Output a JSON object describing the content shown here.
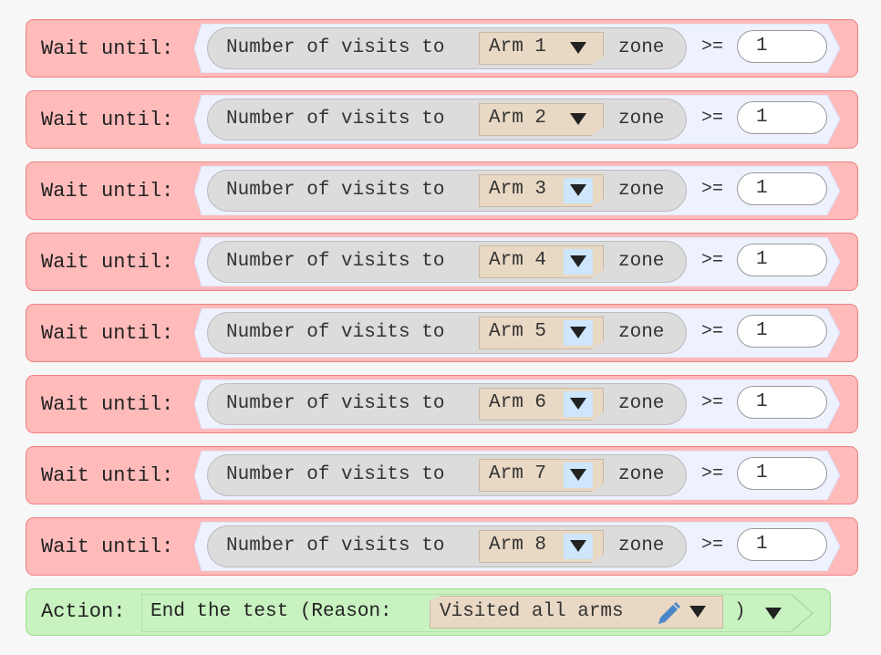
{
  "conditions": [
    {
      "label": "Wait until:",
      "prefix": "Number of visits to",
      "zone": "Arm 1",
      "suffix": "zone",
      "operator": ">=",
      "value": "1",
      "arrow_highlighted": false
    },
    {
      "label": "Wait until:",
      "prefix": "Number of visits to",
      "zone": "Arm 2",
      "suffix": "zone",
      "operator": ">=",
      "value": "1",
      "arrow_highlighted": false
    },
    {
      "label": "Wait until:",
      "prefix": "Number of visits to",
      "zone": "Arm 3",
      "suffix": "zone",
      "operator": ">=",
      "value": "1",
      "arrow_highlighted": true
    },
    {
      "label": "Wait until:",
      "prefix": "Number of visits to",
      "zone": "Arm 4",
      "suffix": "zone",
      "operator": ">=",
      "value": "1",
      "arrow_highlighted": true
    },
    {
      "label": "Wait until:",
      "prefix": "Number of visits to",
      "zone": "Arm 5",
      "suffix": "zone",
      "operator": ">=",
      "value": "1",
      "arrow_highlighted": true
    },
    {
      "label": "Wait until:",
      "prefix": "Number of visits to",
      "zone": "Arm 6",
      "suffix": "zone",
      "operator": ">=",
      "value": "1",
      "arrow_highlighted": true
    },
    {
      "label": "Wait until:",
      "prefix": "Number of visits to",
      "zone": "Arm 7",
      "suffix": "zone",
      "operator": ">=",
      "value": "1",
      "arrow_highlighted": true
    },
    {
      "label": "Wait until:",
      "prefix": "Number of visits to",
      "zone": "Arm 8",
      "suffix": "zone",
      "operator": ">=",
      "value": "1",
      "arrow_highlighted": true
    }
  ],
  "action": {
    "label": "Action:",
    "text": "End the test (Reason:",
    "reason": "Visited all arms",
    "close_paren": ")",
    "icons": {
      "edit": "pencil-icon",
      "dropdown": "triangle-down-icon"
    }
  },
  "colors": {
    "condition_block": "#ffbaba",
    "action_block": "#c8f2c0",
    "dropdown_bg": "#e8d8c4",
    "highlight": "#cde6fb",
    "pencil": "#4a86c8"
  }
}
